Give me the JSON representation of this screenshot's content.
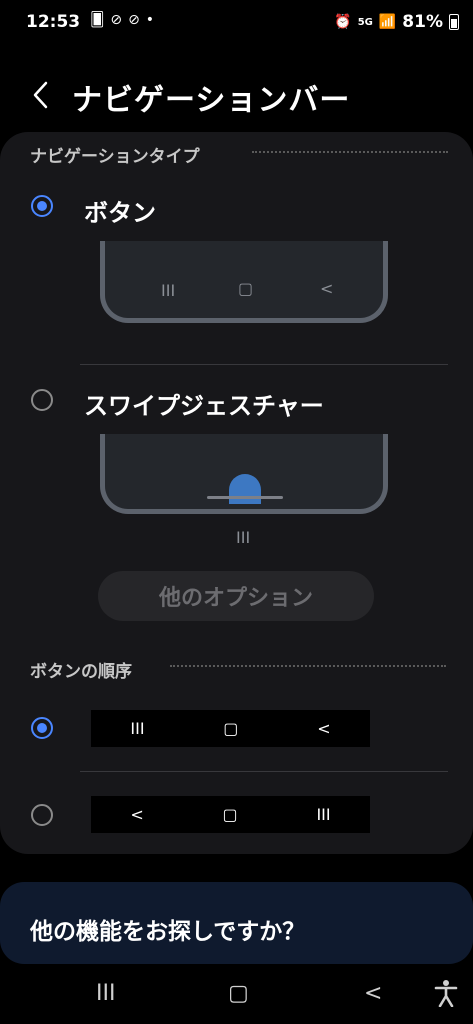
{
  "status": {
    "time": "12:53",
    "left_icons": [
      "🂠",
      "⊘",
      "⊘",
      "•"
    ],
    "network": "5G",
    "battery": "81%"
  },
  "header": {
    "title": "ナビゲーションバー"
  },
  "nav_type": {
    "section_label": "ナビゲーションタイプ",
    "options": [
      {
        "label": "ボタン",
        "selected": true
      },
      {
        "label": "スワイプジェスチャー",
        "selected": false
      }
    ],
    "button_preview_glyphs": [
      "III",
      "▢",
      "<"
    ],
    "gesture_hint_glyph": "III",
    "more_options_label": "他のオプション"
  },
  "button_order": {
    "section_label": "ボタンの順序",
    "options": [
      {
        "glyphs": [
          "III",
          "▢",
          "<"
        ],
        "selected": true
      },
      {
        "glyphs": [
          "<",
          "▢",
          "III"
        ],
        "selected": false
      }
    ]
  },
  "more_features": {
    "text": "他の機能をお探しですか？"
  },
  "system_nav": {
    "recent": "III",
    "home": "▢",
    "back": "<"
  },
  "colors": {
    "accent": "#4a86ff",
    "card": "#17171a",
    "banner": "#0f1a2e"
  }
}
